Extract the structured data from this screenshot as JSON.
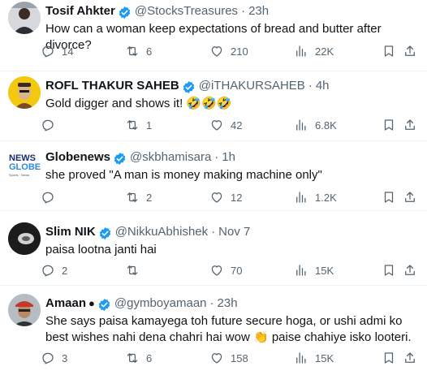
{
  "tweets": [
    {
      "name": "Tosif Ahkter",
      "handle": "@StocksTreasures",
      "time": "23h",
      "text": "How can a woman keep expectations of bread and butter after divorce?",
      "replies": "14",
      "retweets": "6",
      "likes": "210",
      "views": "22K",
      "avatar": "man-profile-photo"
    },
    {
      "name": "ROFL THAKUR SAHEB",
      "handle": "@iTHAKURSAHEB",
      "time": "4h",
      "text": "Gold digger and shows it! 🤣🤣🤣",
      "replies": "",
      "retweets": "1",
      "likes": "42",
      "views": "6.8K",
      "avatar": "cartoon-on-yellow"
    },
    {
      "name": "Globenews",
      "handle": "@skbhamisara",
      "time": "1h",
      "text": "she proved \"A man is money making machine only\"",
      "replies": "",
      "retweets": "2",
      "likes": "12",
      "views": "1.2K",
      "avatar": "news-globe-logo",
      "avatar_text": [
        "NEWS",
        "GLOBE",
        "Sports · News"
      ]
    },
    {
      "name": "Slim NIK",
      "handle": "@NikkuAbhishek",
      "time": "Nov 7",
      "text": "paisa lootna janti hai",
      "replies": "2",
      "retweets": "",
      "likes": "70",
      "views": "15K",
      "avatar": "dark-photo"
    },
    {
      "name": "Amaan",
      "handle": "@gymboyamaan",
      "time": "23h",
      "text": "She says paisa kamayega toh future secure hoga, or ushi admi ko best wishes nahi dena chahri hai wow 👏 paise chahiye isko looteri.",
      "replies": "3",
      "retweets": "6",
      "likes": "158",
      "views": "15K",
      "avatar": "man-cap-photo"
    }
  ],
  "dot": "·",
  "colors": {
    "verified": "#1d9bf0",
    "secondary_text": "#536471",
    "primary_text": "#0f1419",
    "divider": "#eff3f4"
  }
}
